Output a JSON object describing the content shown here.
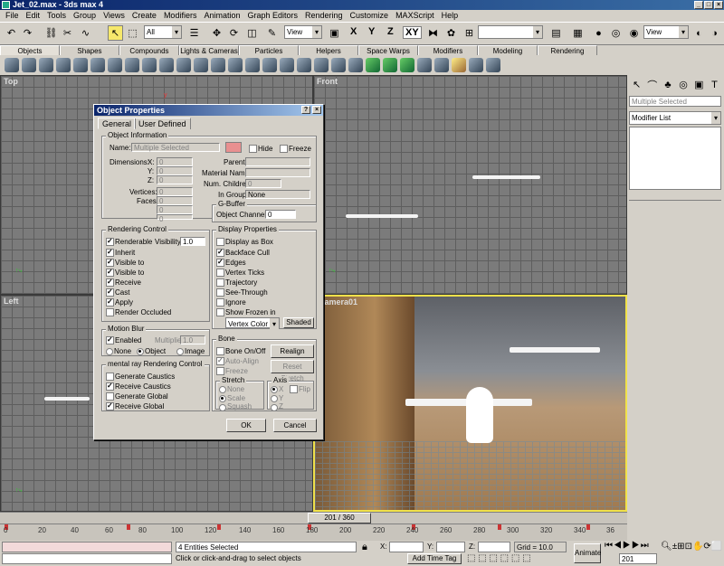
{
  "window": {
    "title": "Jet_02.max - 3ds max 4"
  },
  "menu": [
    "File",
    "Edit",
    "Tools",
    "Group",
    "Views",
    "Create",
    "Modifiers",
    "Animation",
    "Graph Editors",
    "Rendering",
    "Customize",
    "MAXScript",
    "Help"
  ],
  "toolbar": {
    "selection_filter": "All",
    "ref_coord": "View",
    "axis_x": "X",
    "axis_y": "Y",
    "axis_z": "Z",
    "axis_xy": "XY",
    "named_sel": "",
    "view_combo": "View"
  },
  "create_tabs": [
    "Objects",
    "Shapes",
    "Compounds",
    "Lights & Cameras",
    "Particles",
    "Helpers",
    "Space Warps",
    "Modifiers",
    "Modeling",
    "Rendering"
  ],
  "viewports": {
    "top": "Top",
    "front": "Front",
    "left": "Left",
    "camera": "Camera01"
  },
  "command_panel": {
    "name_field": "Multiple Selected",
    "modifier_list": "Modifier List"
  },
  "dialog": {
    "title": "Object Properties",
    "tabs": [
      "General",
      "User Defined"
    ],
    "object_info": {
      "group": "Object Information",
      "name_label": "Name:",
      "name_value": "Multiple Selected",
      "hide": "Hide",
      "freeze": "Freeze",
      "dimensions": "Dimensions:",
      "x": "X:",
      "y": "Y:",
      "z": "Z:",
      "x_val": "0",
      "y_val": "0",
      "z_val": "0",
      "vertices": "Vertices:",
      "faces": "Faces:",
      "vert_val": "0",
      "face_val": "0",
      "v3": "0",
      "v4": "0",
      "parent": "Parent:",
      "material": "Material Name:",
      "children": "Num. Children:",
      "children_val": "0",
      "in_group": "In Group:",
      "in_group_val": "None"
    },
    "gbuffer": {
      "group": "G-Buffer",
      "channel_label": "Object Channel:",
      "channel_val": "0"
    },
    "rendering": {
      "group": "Rendering Control",
      "renderable": "Renderable",
      "visibility": "Visibility:",
      "visibility_val": "1.0",
      "inherit": "Inherit",
      "vis_camera": "Visible to",
      "vis_reflect": "Visible to",
      "receive": "Receive",
      "cast": "Cast",
      "apply": "Apply",
      "occluded": "Render Occluded"
    },
    "display": {
      "group": "Display Properties",
      "as_box": "Display as Box",
      "backface": "Backface Cull",
      "edges": "Edges",
      "vticks": "Vertex Ticks",
      "trajectory": "Trajectory",
      "seethrough": "See-Through",
      "ignore": "Ignore",
      "frozen": "Show Frozen in",
      "vcolor": "Vertex Color",
      "shaded": "Shaded"
    },
    "motion_blur": {
      "group": "Motion Blur",
      "enabled": "Enabled",
      "multiplier": "Multiplier:",
      "mult_val": "1.0",
      "none": "None",
      "object": "Object",
      "image": "Image"
    },
    "mental_ray": {
      "group": "mental ray Rendering Control",
      "gen_caustics": "Generate Caustics",
      "rec_caustics": "Receive Caustics",
      "gen_global": "Generate Global",
      "rec_global": "Receive Global"
    },
    "bone": {
      "group": "Bone",
      "onoff": "Bone On/Off",
      "realign": "Realign",
      "autoalign": "Auto-Align",
      "reset": "Reset Stretch",
      "freeze": "Freeze",
      "stretch": "Stretch",
      "none": "None",
      "scale": "Scale",
      "squash": "Squash",
      "axis": "Axis",
      "x": "X",
      "y": "Y",
      "z": "Z",
      "flip": "Flip"
    },
    "ok": "OK",
    "cancel": "Cancel"
  },
  "timeline": {
    "frame": "201 / 360",
    "ticks": [
      "0",
      "20",
      "40",
      "60",
      "80",
      "100",
      "120",
      "140",
      "160",
      "180",
      "200",
      "220",
      "240",
      "260",
      "280",
      "300",
      "320",
      "340",
      "36"
    ]
  },
  "status": {
    "selected": "4 Entities Selected",
    "prompt": "Click or click-and-drag to select objects",
    "x_label": "X:",
    "y_label": "Y:",
    "z_label": "Z:",
    "grid": "Grid = 10.0",
    "add_time_tag": "Add Time Tag",
    "animate": "Animate",
    "frame": "201"
  }
}
